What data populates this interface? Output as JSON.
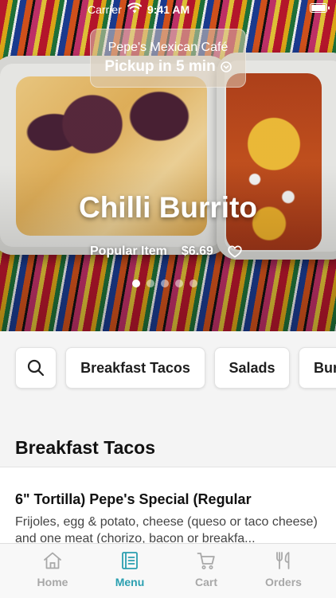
{
  "status_bar": {
    "carrier": "Carrier",
    "time": "9:41 AM"
  },
  "store": {
    "name": "Pepe's Mexican Café",
    "pickup": "Pickup in 5 min"
  },
  "featured": {
    "title": "Chilli Burrito",
    "tag": "Popular Item",
    "price": "$6.69",
    "carousel_count": 5,
    "carousel_active_index": 0
  },
  "categories": [
    "Breakfast Tacos",
    "Salads",
    "Bur"
  ],
  "section": {
    "title": "Breakfast Tacos",
    "items": [
      {
        "name": "6\" Tortilla) Pepe's Special (Regular",
        "description": "Frijoles, egg & potato, cheese (queso or taco cheese) and one meat (chorizo, bacon or breakfa..."
      }
    ]
  },
  "tabs": [
    {
      "label": "Home",
      "icon": "home-icon",
      "active": false
    },
    {
      "label": "Menu",
      "icon": "menu-book-icon",
      "active": true
    },
    {
      "label": "Cart",
      "icon": "cart-icon",
      "active": false
    },
    {
      "label": "Orders",
      "icon": "fork-knife-icon",
      "active": false
    }
  ],
  "colors": {
    "accent": "#2a9fb0",
    "inactive_tab": "#a8a8a8"
  }
}
